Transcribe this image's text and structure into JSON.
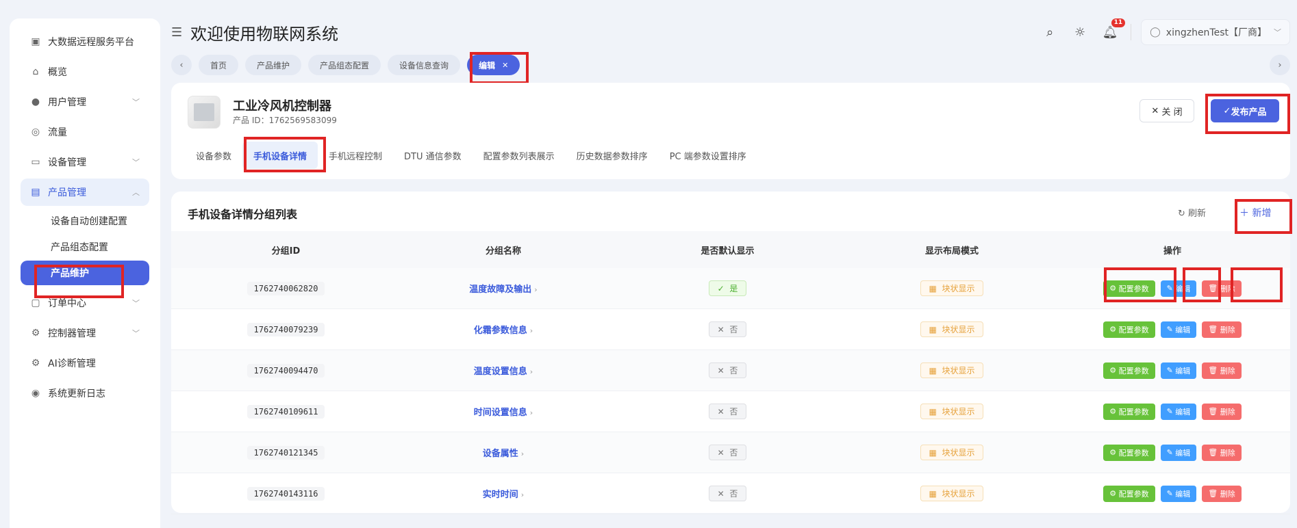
{
  "app": {
    "title": "欢迎使用物联网系统"
  },
  "sidebar": {
    "items": [
      {
        "label": "大数据远程服务平台",
        "icon": "monitor-icon"
      },
      {
        "label": "概览",
        "icon": "home-icon"
      },
      {
        "label": "用户管理",
        "icon": "user-icon"
      },
      {
        "label": "流量",
        "icon": "traffic-icon"
      },
      {
        "label": "设备管理",
        "icon": "device-icon"
      },
      {
        "label": "产品管理",
        "icon": "product-icon"
      }
    ],
    "sub_items": [
      "设备自动创建配置",
      "产品组态配置",
      "产品维护"
    ],
    "bottom_items": [
      {
        "label": "订单中心",
        "icon": "order-icon"
      },
      {
        "label": "控制器管理",
        "icon": "gear-icon"
      },
      {
        "label": "AI诊断管理",
        "icon": "gear-icon"
      },
      {
        "label": "系统更新日志",
        "icon": "log-icon"
      }
    ]
  },
  "header": {
    "notif_count": "11",
    "user": "xingzhenTest【厂商】"
  },
  "page_tabs": [
    "首页",
    "产品维护",
    "产品组态配置",
    "设备信息查询",
    "编辑"
  ],
  "product": {
    "name": "工业冷风机控制器",
    "id_text": "产品 ID：1762569583099",
    "close_label": "关 闭",
    "publish_label": "发布产品",
    "tabs": [
      "设备参数",
      "手机设备详情",
      "手机远程控制",
      "DTU 通信参数",
      "配置参数列表展示",
      "历史数据参数排序",
      "PC 端参数设置排序"
    ]
  },
  "list": {
    "title": "手机设备详情分组列表",
    "refresh_label": "刷新",
    "add_label": "新增",
    "columns": [
      "分组ID",
      "分组名称",
      "是否默认显示",
      "显示布局模式",
      "操作"
    ],
    "rows": [
      {
        "id": "1762740062820",
        "name": "温度故障及输出",
        "default": "是",
        "layout": "块状显示"
      },
      {
        "id": "1762740079239",
        "name": "化霜参数信息",
        "default": "否",
        "layout": "块状显示"
      },
      {
        "id": "1762740094470",
        "name": "温度设置信息",
        "default": "否",
        "layout": "块状显示"
      },
      {
        "id": "1762740109611",
        "name": "时间设置信息",
        "default": "否",
        "layout": "块状显示"
      },
      {
        "id": "1762740121345",
        "name": "设备属性",
        "default": "否",
        "layout": "块状显示"
      },
      {
        "id": "1762740143116",
        "name": "实时时间",
        "default": "否",
        "layout": "块状显示"
      }
    ],
    "ops": {
      "config": "配置参数",
      "edit": "编辑",
      "delete": "删除"
    }
  }
}
